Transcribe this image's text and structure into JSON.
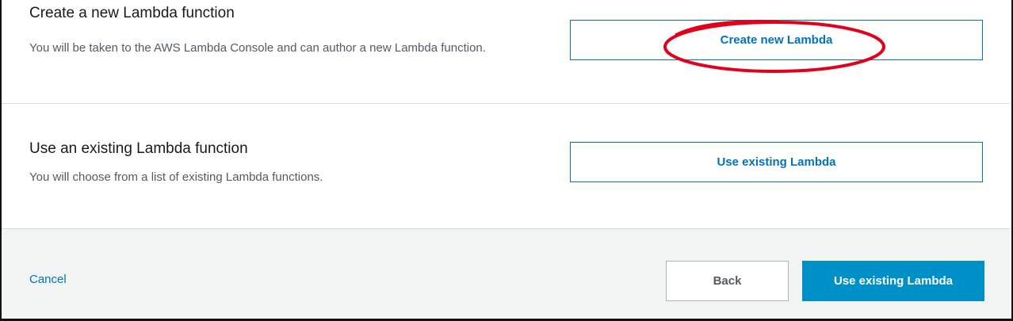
{
  "create_section": {
    "title": "Create a new Lambda function",
    "description": "You will be taken to the AWS Lambda Console and can author a new Lambda function.",
    "button_label": "Create new Lambda"
  },
  "existing_section": {
    "title": "Use an existing Lambda function",
    "description": "You will choose from a list of existing Lambda functions.",
    "button_label": "Use existing Lambda"
  },
  "footer": {
    "cancel_label": "Cancel",
    "back_label": "Back",
    "primary_label": "Use existing Lambda"
  },
  "colors": {
    "link_blue": "#0073bb",
    "primary_button": "#0090c8",
    "annotation_red": "#e3001b"
  }
}
